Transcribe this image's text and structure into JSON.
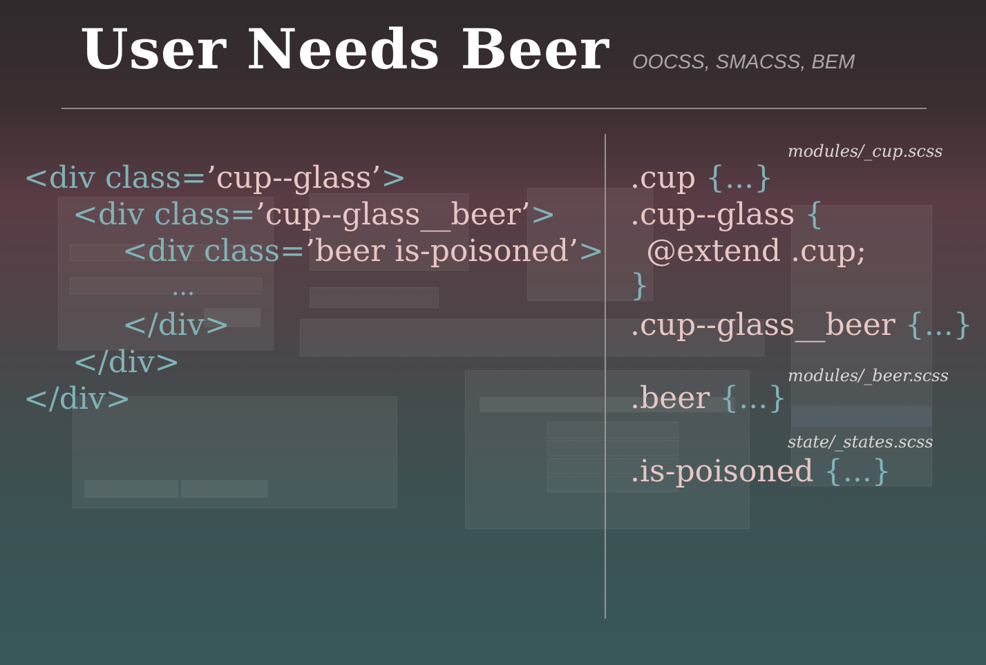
{
  "slide": {
    "title": "User Needs Beer",
    "subtitle": "OOCSS, SMACSS, BEM"
  },
  "html_code": {
    "line1_a": "<div class=",
    "line1_b": "’cup--glass’",
    "line1_c": ">",
    "line2_a": "<div class=",
    "line2_b": "’cup--glass__beer’",
    "line2_c": ">",
    "line3_a": "<div class=",
    "line3_b": "’beer is-poisoned’",
    "line3_c": ">",
    "line4": "...",
    "line5": "</div>",
    "line6": "</div>",
    "line7": "</div>"
  },
  "scss_code": {
    "file_cup": "modules/_cup.scss",
    "cup_sel": ".cup",
    "cup_body": " {...}",
    "glass_sel": ".cup--glass",
    "glass_open": " {",
    "extend_line": "@extend .cup;",
    "close_brace": "}",
    "beer_el_sel": ".cup--glass__beer",
    "beer_el_body": " {...}",
    "file_beer": "modules/_beer.scss",
    "beer_sel": ".beer",
    "beer_body": " {...}",
    "file_states": "state/_states.scss",
    "poison_sel": ".is-poisoned",
    "poison_body": " {...}"
  },
  "colors": {
    "markup": "#7fb3b8",
    "value": "#e9c5c4"
  }
}
